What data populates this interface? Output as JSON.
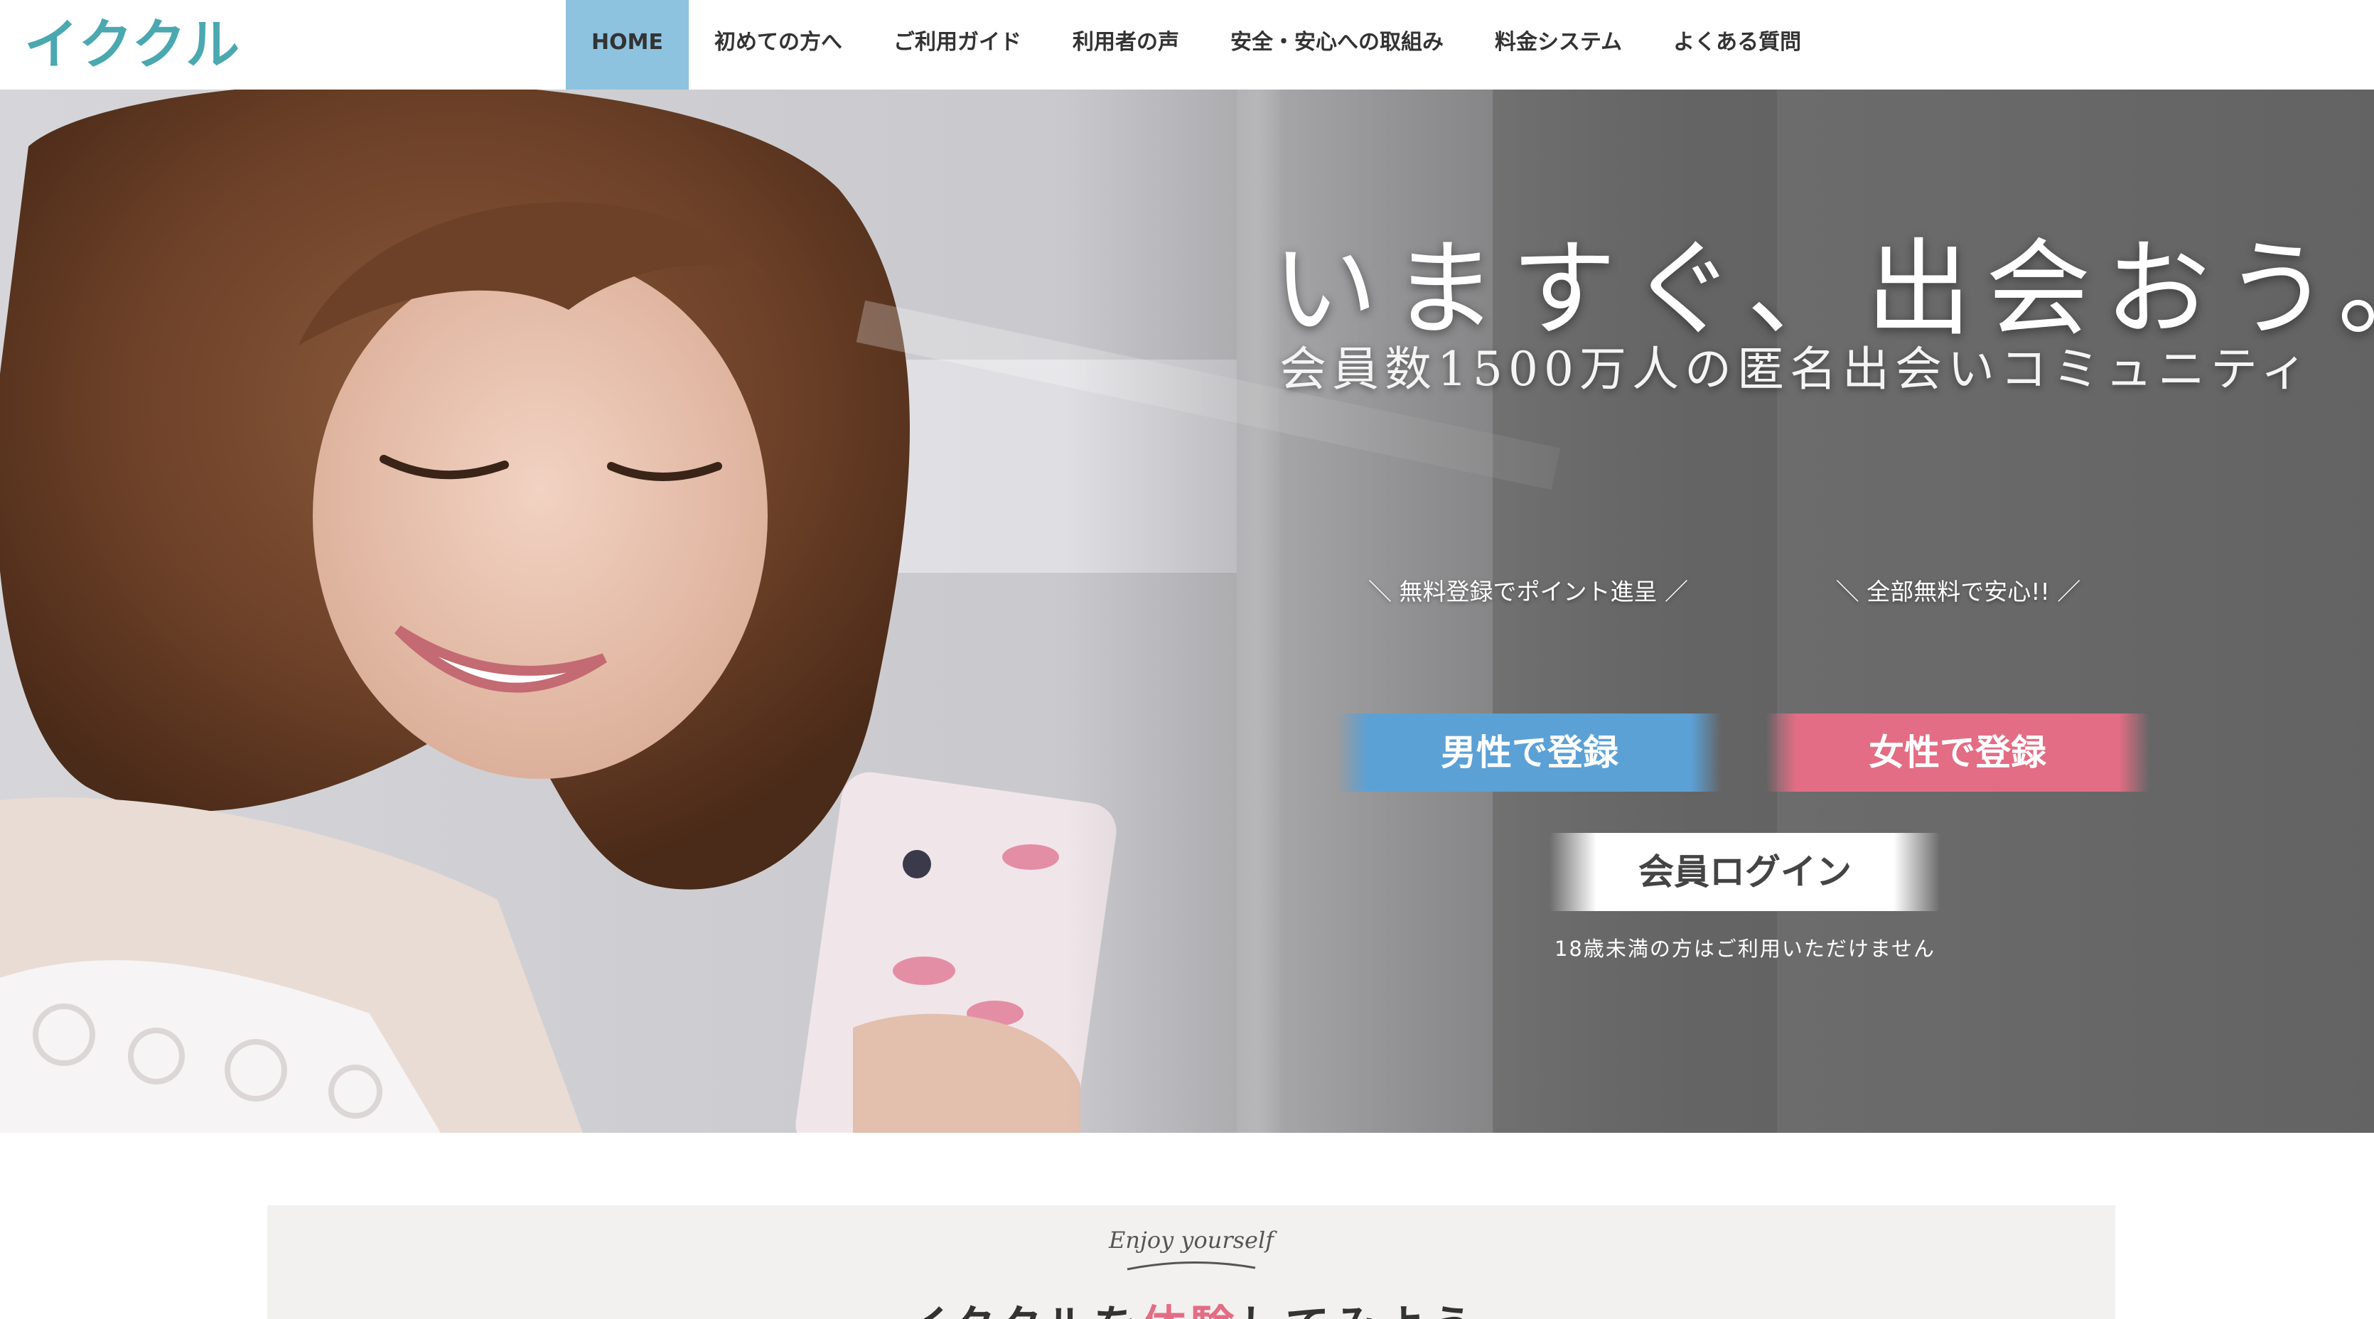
{
  "header": {
    "logo": "イククル",
    "nav": [
      {
        "label": "HOME",
        "active": true
      },
      {
        "label": "初めての方へ",
        "active": false
      },
      {
        "label": "ご利用ガイド",
        "active": false
      },
      {
        "label": "利用者の声",
        "active": false
      },
      {
        "label": "安全・安心への取組み",
        "active": false
      },
      {
        "label": "料金システム",
        "active": false
      },
      {
        "label": "よくある質問",
        "active": false
      }
    ]
  },
  "hero": {
    "headline": "いますぐ、出会おう。",
    "subheadline": "会員数1500万人の匿名出会いコミュニティ",
    "male_caption": "＼ 無料登録でポイント進呈 ／",
    "female_caption": "＼ 全部無料で安心!! ／",
    "male_button": "男性で登録",
    "female_button": "女性で登録",
    "login_button": "会員ログイン",
    "age_note": "18歳未満の方はご利用いただけません"
  },
  "intro": {
    "script": "Enjoy yourself",
    "title_before": "イククルを",
    "title_accent": "体験",
    "title_after": "してみよう"
  },
  "colors": {
    "brand": "#4aa8b0",
    "nav_active": "#8ec3e0",
    "male": "#5ba1d6",
    "female": "#e36d84",
    "hero_dark": "#636363"
  },
  "icons": [
    "script-swoosh-icon"
  ]
}
